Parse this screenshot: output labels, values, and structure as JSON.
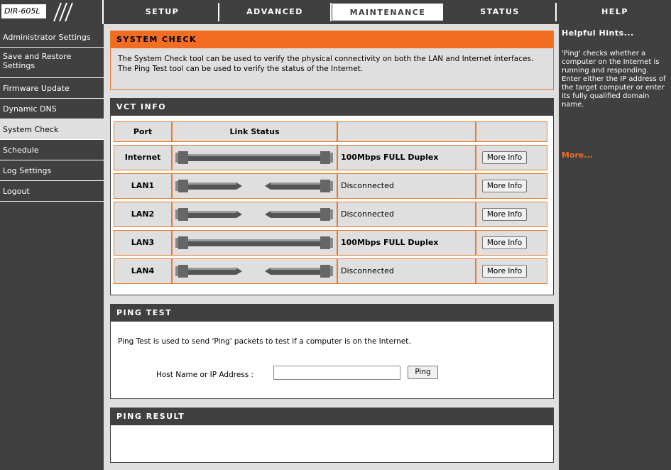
{
  "header": {
    "model": "DIR-605L",
    "tabs": [
      {
        "label": "SETUP"
      },
      {
        "label": "ADVANCED"
      },
      {
        "label": "MAINTENANCE"
      },
      {
        "label": "STATUS"
      },
      {
        "label": "HELP"
      }
    ],
    "active_tab": "MAINTENANCE"
  },
  "sidebar": {
    "items": [
      {
        "label": "Administrator Settings"
      },
      {
        "label": "Save and Restore Settings"
      },
      {
        "label": "Firmware Update"
      },
      {
        "label": "Dynamic DNS"
      },
      {
        "label": "System Check"
      },
      {
        "label": "Schedule"
      },
      {
        "label": "Log Settings"
      },
      {
        "label": "Logout"
      }
    ],
    "active_item": "System Check"
  },
  "system_check": {
    "title": "SYSTEM CHECK",
    "description": "The System Check tool can be used to verify the physical connectivity on both the LAN and Internet interfaces. The Ping Test tool can be used to verify the status of the Internet."
  },
  "vct": {
    "title": "VCT INFO",
    "columns": [
      "Port",
      "Link Status",
      "",
      ""
    ],
    "rows": [
      {
        "port": "Internet",
        "connected": true,
        "status": "100Mbps FULL Duplex",
        "button": "More Info"
      },
      {
        "port": "LAN1",
        "connected": false,
        "status": "Disconnected",
        "button": "More Info"
      },
      {
        "port": "LAN2",
        "connected": false,
        "status": "Disconnected",
        "button": "More Info"
      },
      {
        "port": "LAN3",
        "connected": true,
        "status": "100Mbps FULL Duplex",
        "button": "More Info"
      },
      {
        "port": "LAN4",
        "connected": false,
        "status": "Disconnected",
        "button": "More Info"
      }
    ]
  },
  "ping_test": {
    "title": "PING TEST",
    "description": "Ping Test is used to send 'Ping' packets to test if a computer is on the Internet.",
    "host_label": "Host Name or IP Address  :",
    "host_value": "",
    "ping_button": "Ping"
  },
  "ping_result": {
    "title": "PING RESULT"
  },
  "help": {
    "title": "Helpful Hints...",
    "text": "'Ping' checks whether a computer on the Internet is running and responding. Enter either the IP address of the target computer or enter its fully qualified domain name.",
    "more": "More..."
  },
  "colors": {
    "dark": "#404040",
    "orange": "#f26c22",
    "panel": "#dfdfdf"
  }
}
